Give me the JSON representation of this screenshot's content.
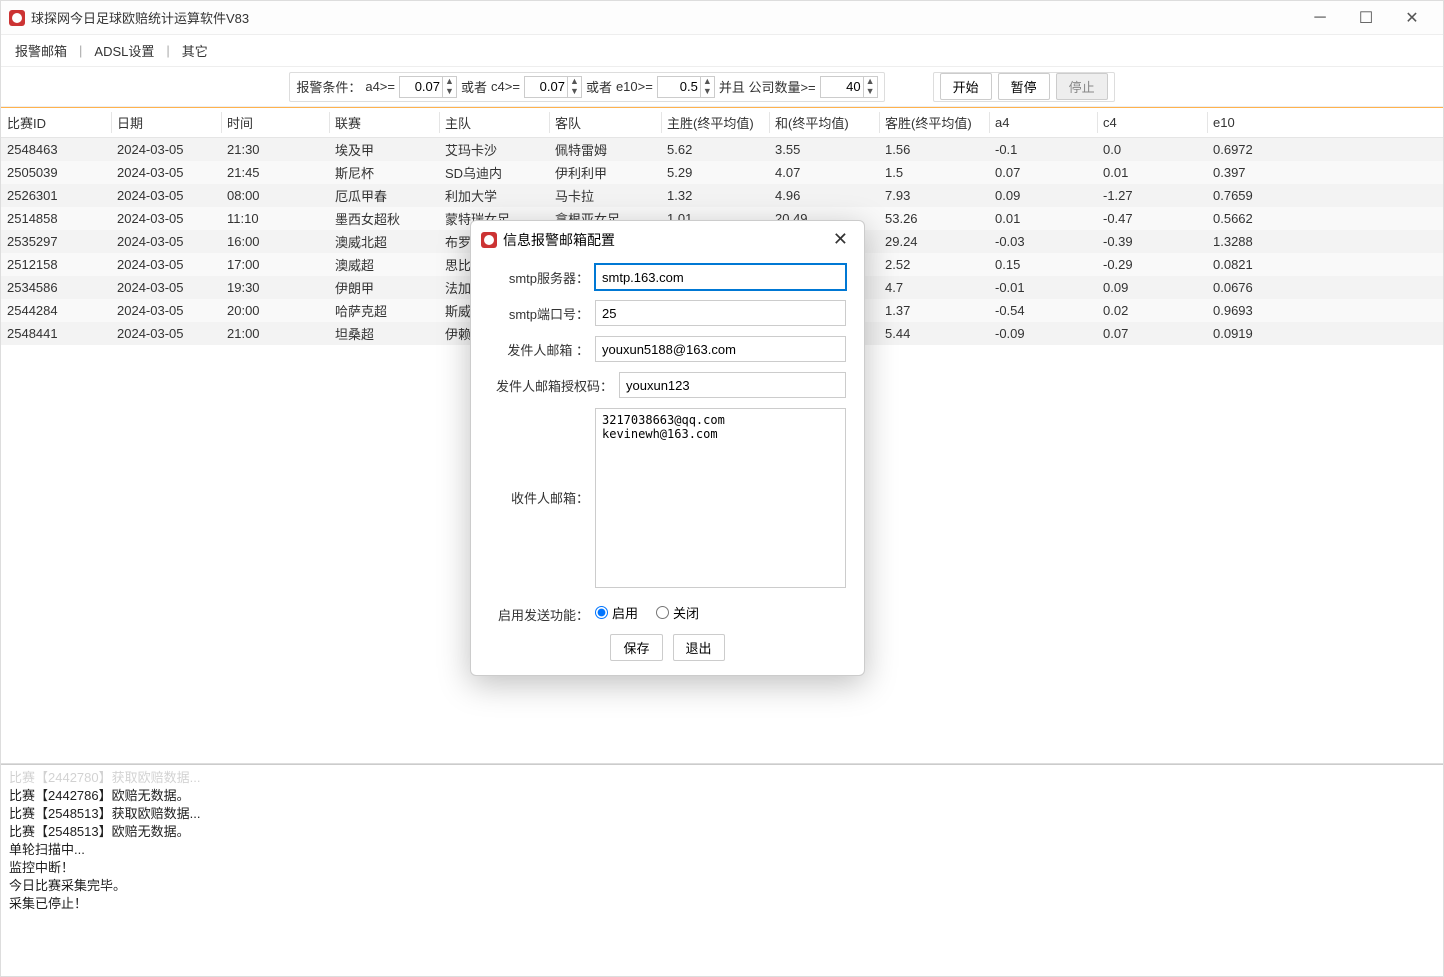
{
  "window": {
    "title": "球探网今日足球欧赔统计运算软件V83"
  },
  "menu": {
    "alertEmail": "报警邮箱",
    "adsl": "ADSL设置",
    "other": "其它"
  },
  "filters": {
    "condLabel": "报警条件：",
    "a4Label": "a4>=",
    "a4": "0.07",
    "or1": "或者",
    "c4Label": "c4>=",
    "c4": "0.07",
    "or2": "或者",
    "e10Label": "e10>=",
    "e10": "0.5",
    "andLabel": "并且 公司数量>=",
    "companies": "40"
  },
  "buttons": {
    "start": "开始",
    "pause": "暂停",
    "stop": "停止"
  },
  "columns": [
    "比赛ID",
    "日期",
    "时间",
    "联赛",
    "主队",
    "客队",
    "主胜(终平均值)",
    "和(终平均值)",
    "客胜(终平均值)",
    "a4",
    "c4",
    "e10"
  ],
  "rows": [
    [
      "2548463",
      "2024-03-05",
      "21:30",
      "埃及甲",
      "艾玛卡沙",
      "佩特雷姆",
      "5.62",
      "3.55",
      "1.56",
      "-0.1",
      "0.0",
      "0.6972"
    ],
    [
      "2505039",
      "2024-03-05",
      "21:45",
      "斯尼杯",
      "SD乌迪内",
      "伊利利甲",
      "5.29",
      "4.07",
      "1.5",
      "0.07",
      "0.01",
      "0.397"
    ],
    [
      "2526301",
      "2024-03-05",
      "08:00",
      "厄瓜甲春",
      "利加大学",
      "马卡拉",
      "1.32",
      "4.96",
      "7.93",
      "0.09",
      "-1.27",
      "0.7659"
    ],
    [
      "2514858",
      "2024-03-05",
      "11:10",
      "墨西女超秋",
      "蒙特瑞女足",
      "拿根亚女足",
      "1.01",
      "20.49",
      "53.26",
      "0.01",
      "-0.47",
      "0.5662"
    ],
    [
      "2535297",
      "2024-03-05",
      "16:00",
      "澳威北超",
      "布罗",
      "",
      "",
      "",
      "29.24",
      "-0.03",
      "-0.39",
      "1.3288"
    ],
    [
      "2512158",
      "2024-03-05",
      "17:00",
      "澳威超",
      "思比",
      "",
      "",
      "",
      "2.52",
      "0.15",
      "-0.29",
      "0.0821"
    ],
    [
      "2534586",
      "2024-03-05",
      "19:30",
      "伊朗甲",
      "法加",
      "",
      "",
      "",
      "4.7",
      "-0.01",
      "0.09",
      "0.0676"
    ],
    [
      "2544284",
      "2024-03-05",
      "20:00",
      "哈萨克超",
      "斯威",
      "",
      "",
      "",
      "1.37",
      "-0.54",
      "0.02",
      "0.9693"
    ],
    [
      "2548441",
      "2024-03-05",
      "21:00",
      "坦桑超",
      "伊赖",
      "",
      "",
      "",
      "5.44",
      "-0.09",
      "0.07",
      "0.0919"
    ]
  ],
  "log": [
    {
      "text": "比赛【2442780】获取欧赔数据...",
      "cls": "o"
    },
    {
      "text": "比赛【2442786】欧赔无数据。",
      "cls": ""
    },
    {
      "text": "比赛【2548513】获取欧赔数据...",
      "cls": ""
    },
    {
      "text": "比赛【2548513】欧赔无数据。",
      "cls": ""
    },
    {
      "text": "单轮扫描中...",
      "cls": ""
    },
    {
      "text": "监控中断！",
      "cls": ""
    },
    {
      "text": "今日比赛采集完毕。",
      "cls": ""
    },
    {
      "text": "采集已停止！",
      "cls": ""
    }
  ],
  "dialog": {
    "title": "信息报警邮箱配置",
    "smtpServerLabel": "smtp服务器：",
    "smtpServer": "smtp.163.com",
    "smtpPortLabel": "smtp端口号：",
    "smtpPort": "25",
    "senderLabel": "发件人邮箱 ：",
    "sender": "youxun5188@163.com",
    "authLabel": "发件人邮箱授权码：",
    "auth": "youxun123",
    "recipientsLabel": "收件人邮箱：",
    "recipients": "3217038663@qq.com\nkevinewh@163.com",
    "enableLabel": "启用发送功能：",
    "enableOn": "启用",
    "enableOff": "关闭",
    "save": "保存",
    "exit": "退出"
  }
}
